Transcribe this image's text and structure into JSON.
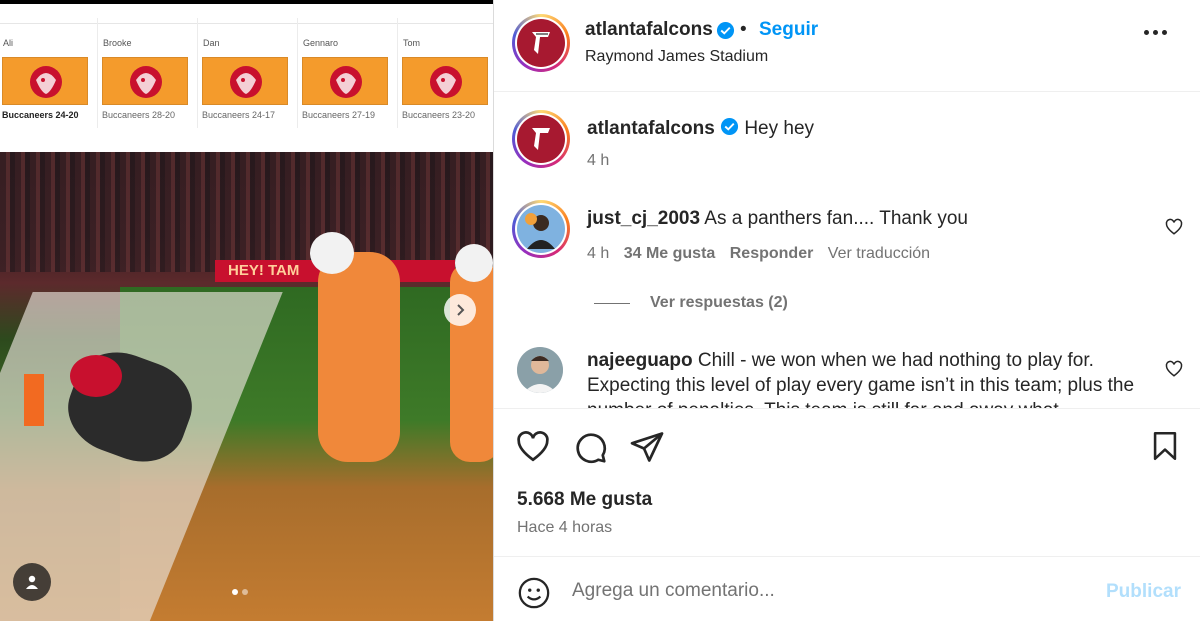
{
  "media": {
    "picks": [
      {
        "name": "Ali",
        "score": "Buccaneers 24-20",
        "bold": true
      },
      {
        "name": "Brooke",
        "score": "Buccaneers 28-20",
        "bold": false
      },
      {
        "name": "Dan",
        "score": "Buccaneers 24-17",
        "bold": false
      },
      {
        "name": "Gennaro",
        "score": "Buccaneers 27-19",
        "bold": false
      },
      {
        "name": "Tom",
        "score": "Buccaneers 23-20",
        "bold": false
      }
    ],
    "banner_text": "HEY! TAM",
    "carousel": {
      "total": 2,
      "active": 1
    }
  },
  "post": {
    "author": "atlantafalcons",
    "separator": "•",
    "follow_label": "Seguir",
    "location": "Raymond James Stadium"
  },
  "caption": {
    "author": "atlantafalcons",
    "text": "Hey hey",
    "time": "4 h"
  },
  "comments": [
    {
      "author": "just_cj_2003",
      "text": "As a panthers fan.... Thank you",
      "time": "4 h",
      "likes": "34 Me gusta",
      "reply": "Responder",
      "translate": "Ver traducción",
      "view_replies": "Ver respuestas (2)"
    },
    {
      "author": "najeeguapo",
      "text": "Chill - we won when we had nothing to play for. Expecting this level of play every game isn’t in this team; plus the number of penalties. This team is still far and away what"
    }
  ],
  "stats": {
    "likes": "5.668 Me gusta",
    "time_ago": "Hace 4 horas"
  },
  "composer": {
    "placeholder": "Agrega un comentario...",
    "publish_label": "Publicar"
  },
  "colors": {
    "accent": "#0095f6",
    "publish_disabled": "#b2dffc",
    "falcons_red": "#a71930",
    "bucs_orange": "#f49b2c"
  }
}
